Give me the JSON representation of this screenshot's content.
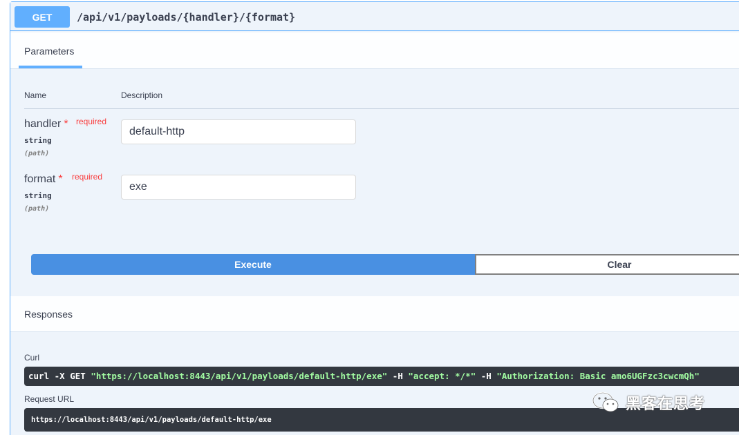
{
  "operation": {
    "method": "GET",
    "path": "/api/v1/payloads/{handler}/{format}"
  },
  "parameters_section": {
    "title": "Parameters",
    "col_name": "Name",
    "col_description": "Description",
    "params": [
      {
        "name": "handler",
        "required_mark": "*",
        "required_label": "required",
        "type": "string",
        "in": "(path)",
        "value": "default-http"
      },
      {
        "name": "format",
        "required_mark": "*",
        "required_label": "required",
        "type": "string",
        "in": "(path)",
        "value": "exe"
      }
    ]
  },
  "actions": {
    "execute_label": "Execute",
    "clear_label": "Clear"
  },
  "responses_section": {
    "title": "Responses",
    "curl_label": "Curl",
    "curl_cmd": "curl -X GET ",
    "curl_url": "\"https://localhost:8443/api/v1/payloads/default-http/exe\"",
    "curl_h1_flag": " -H  ",
    "curl_h1": "\"accept: */*\"",
    "curl_h2_flag": " -H  ",
    "curl_h2": "\"Authorization: Basic amo6UGFzc3cwcmQh\"",
    "request_url_label": "Request URL",
    "request_url": "https://localhost:8443/api/v1/payloads/default-http/exe"
  },
  "watermark": {
    "text": "黑客在思考",
    "icon": "wechat-icon"
  },
  "colors": {
    "get_accent": "#61affe",
    "execute_blue": "#4990e2",
    "required_red": "#f93e3e",
    "code_bg": "#333840",
    "code_string_green": "#a2fca2"
  }
}
